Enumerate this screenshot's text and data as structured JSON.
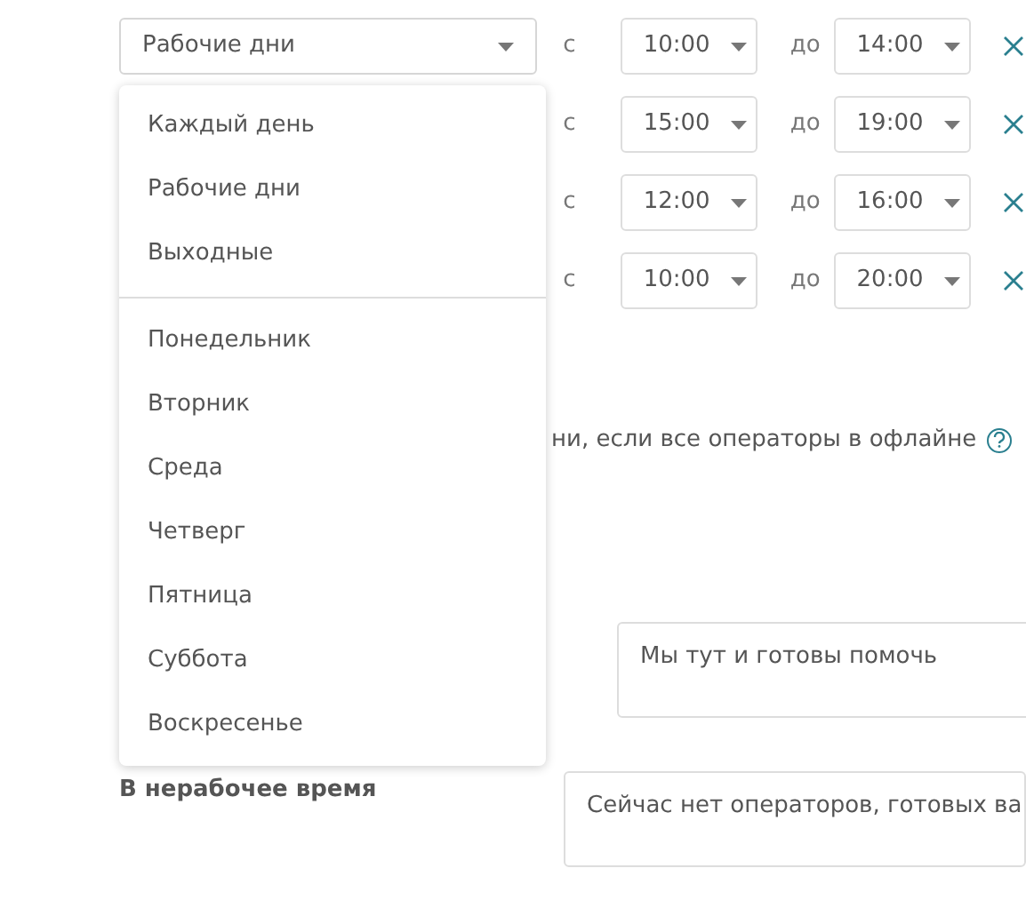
{
  "day_select": {
    "value": "Рабочие дни",
    "expanded": true
  },
  "schedule": [
    {
      "from_label": "с",
      "from": "10:00",
      "to_label": "до",
      "to": "14:00"
    },
    {
      "from_label": "с",
      "from": "15:00",
      "to_label": "до",
      "to": "19:00"
    },
    {
      "from_label": "с",
      "from": "12:00",
      "to_label": "до",
      "to": "16:00"
    },
    {
      "from_label": "с",
      "from": "10:00",
      "to_label": "до",
      "to": "20:00"
    }
  ],
  "day_menu": {
    "groups": [
      [
        "Каждый день",
        "Рабочие дни",
        "Выходные"
      ],
      [
        "Понедельник",
        "Вторник",
        "Среда",
        "Четверг",
        "Пятница",
        "Суббота",
        "Воскресенье"
      ]
    ]
  },
  "offline_option": {
    "label": "ни, если все операторы в офлайне"
  },
  "greeting_field": {
    "value": "Мы тут и готовы помочь"
  },
  "offline_message": {
    "label": "В нерабочее время",
    "value": "Сейчас нет операторов, готовых ва"
  }
}
